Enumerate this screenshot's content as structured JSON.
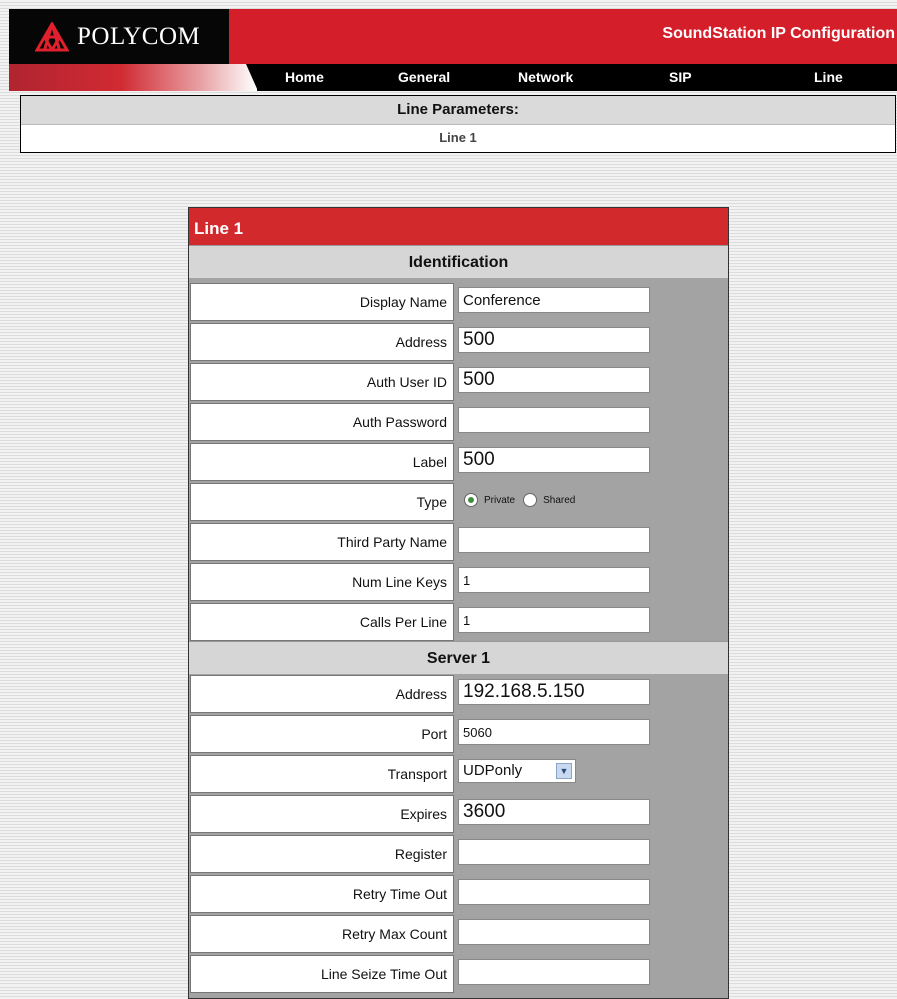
{
  "header": {
    "brand": "POLYCOM",
    "app_title": "SoundStation IP Configuration"
  },
  "nav": {
    "items": [
      {
        "label": "Home"
      },
      {
        "label": "General"
      },
      {
        "label": "Network"
      },
      {
        "label": "SIP"
      },
      {
        "label": "Line"
      }
    ]
  },
  "line_parameters": {
    "heading": "Line Parameters:",
    "subheading": "Line 1"
  },
  "form": {
    "title": "Line 1",
    "identification": {
      "heading": "Identification",
      "display_name": {
        "label": "Display Name",
        "value": "Conference"
      },
      "address": {
        "label": "Address",
        "value": "500"
      },
      "auth_user_id": {
        "label": "Auth User ID",
        "value": "500"
      },
      "auth_password": {
        "label": "Auth Password",
        "value": ""
      },
      "label": {
        "label": "Label",
        "value": "500"
      },
      "type": {
        "label": "Type",
        "options": [
          {
            "label": "Private",
            "checked": true
          },
          {
            "label": "Shared",
            "checked": false
          }
        ]
      },
      "third_party_name": {
        "label": "Third Party Name",
        "value": ""
      },
      "num_line_keys": {
        "label": "Num Line Keys",
        "value": "1"
      },
      "calls_per_line": {
        "label": "Calls Per Line",
        "value": "1"
      }
    },
    "server1": {
      "heading": "Server 1",
      "address": {
        "label": "Address",
        "value": "192.168.5.150"
      },
      "port": {
        "label": "Port",
        "value": "5060"
      },
      "transport": {
        "label": "Transport",
        "value": "UDPonly"
      },
      "expires": {
        "label": "Expires",
        "value": "3600"
      },
      "register": {
        "label": "Register",
        "value": ""
      },
      "retry_time_out": {
        "label": "Retry Time Out",
        "value": ""
      },
      "retry_max_count": {
        "label": "Retry Max Count",
        "value": ""
      },
      "line_seize_time_out": {
        "label": "Line Seize Time Out",
        "value": ""
      }
    }
  },
  "colors": {
    "brand_red": "#d41f2b",
    "panel_gray": "#a3a3a3",
    "radio_checked": "#3f8f3a"
  },
  "icons": {
    "logo": "polycom-logo-icon",
    "dropdown": "chevron-down-icon"
  }
}
